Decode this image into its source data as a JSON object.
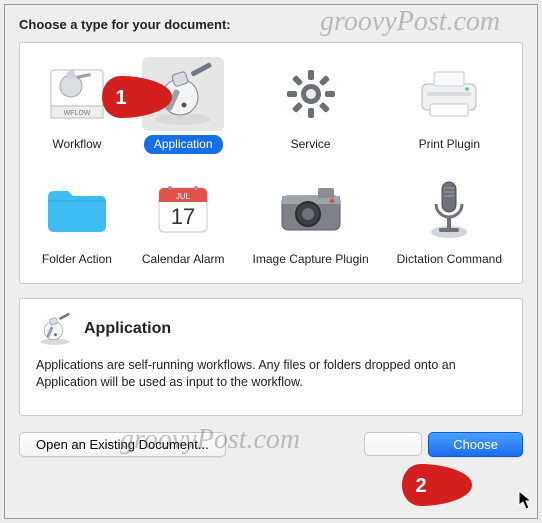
{
  "heading": "Choose a type for your document:",
  "types": [
    {
      "label": "Workflow"
    },
    {
      "label": "Application",
      "selected": true
    },
    {
      "label": "Service"
    },
    {
      "label": "Print Plugin"
    },
    {
      "label": "Folder Action"
    },
    {
      "label": "Calendar Alarm"
    },
    {
      "label": "Image Capture Plugin"
    },
    {
      "label": "Dictation Command"
    }
  ],
  "description": {
    "title": "Application",
    "body": "Applications are self-running workflows. Any files or folders dropped onto an Application will be used as input to the workflow."
  },
  "buttons": {
    "open": "Open an Existing Document...",
    "choose": "Choose"
  },
  "callouts": {
    "c1": "1",
    "c2": "2"
  },
  "watermark": "groovyPost.com",
  "calendar": {
    "month": "JUL",
    "day": "17"
  },
  "wflow_badge": "WFLOW"
}
